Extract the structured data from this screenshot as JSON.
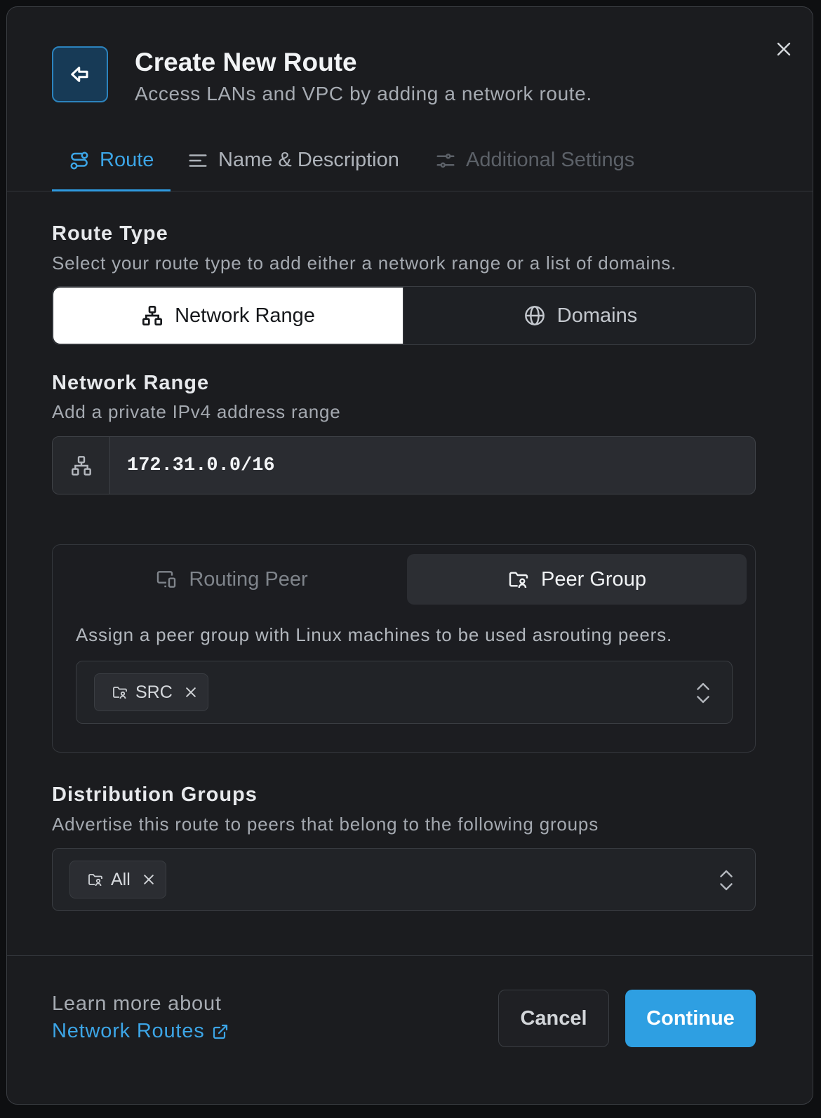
{
  "dialog": {
    "title": "Create New Route",
    "subtitle": "Access LANs and VPC by adding a network route."
  },
  "tabs": [
    {
      "label": "Route",
      "state": "active"
    },
    {
      "label": "Name & Description",
      "state": "normal"
    },
    {
      "label": "Additional Settings",
      "state": "disabled"
    }
  ],
  "route_type": {
    "title": "Route Type",
    "description": "Select your route type to add either a network range or a list of domains.",
    "options": [
      {
        "label": "Network Range",
        "selected": true
      },
      {
        "label": "Domains",
        "selected": false
      }
    ]
  },
  "network_range": {
    "title": "Network Range",
    "description": "Add a private IPv4 address range",
    "value": "172.31.0.0/16"
  },
  "peer_assignment": {
    "tabs": [
      {
        "label": "Routing Peer",
        "selected": false
      },
      {
        "label": "Peer Group",
        "selected": true
      }
    ],
    "description": "Assign a peer group with Linux machines to be used asrouting peers.",
    "selected_groups": [
      "SRC"
    ]
  },
  "distribution_groups": {
    "title": "Distribution Groups",
    "description": "Advertise this route to peers that belong to the following groups",
    "selected_groups": [
      "All"
    ]
  },
  "footer": {
    "learn_more": "Learn more about",
    "link_label": "Network Routes",
    "cancel_label": "Cancel",
    "continue_label": "Continue"
  },
  "colors": {
    "accent": "#2e9fe2",
    "background": "#1b1c1f",
    "border": "#3a3d42"
  },
  "icons": [
    "close-icon",
    "route-arrow-icon",
    "route-tab-icon",
    "text-lines-icon",
    "settings-sliders-icon",
    "network-icon",
    "globe-icon",
    "devices-icon",
    "folder-group-icon",
    "x-icon",
    "chevron-updown-icon",
    "external-link-icon"
  ]
}
